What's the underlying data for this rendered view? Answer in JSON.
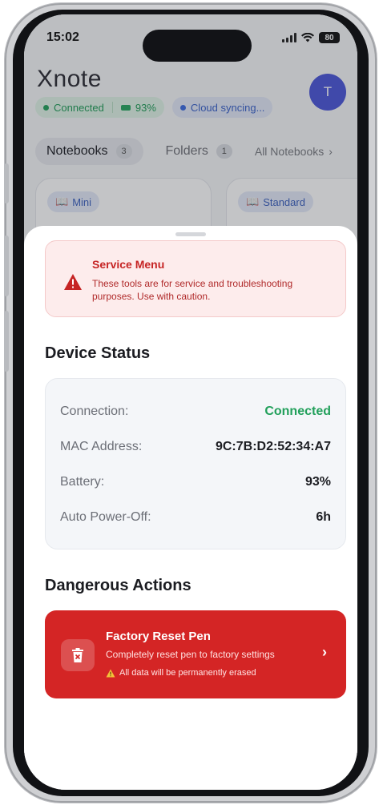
{
  "status_bar": {
    "time": "15:02",
    "battery": "80"
  },
  "app": {
    "logo": "Xnote",
    "avatar_initial": "T",
    "badges": {
      "connection": "Connected",
      "battery": "93%",
      "sync": "Cloud syncing..."
    },
    "tabs": [
      {
        "label": "Notebooks",
        "count": "3"
      },
      {
        "label": "Folders",
        "count": "1"
      }
    ],
    "all_notebooks_link": "All Notebooks",
    "notebook_tags": [
      "Mini",
      "Standard"
    ]
  },
  "sheet": {
    "warning": {
      "title": "Service Menu",
      "text": "These tools are for service and troubleshooting purposes. Use with caution."
    },
    "device_status": {
      "title": "Device Status",
      "rows": [
        {
          "label": "Connection:",
          "value": "Connected"
        },
        {
          "label": "MAC Address:",
          "value": "9C:7B:D2:52:34:A7"
        },
        {
          "label": "Battery:",
          "value": "93%"
        },
        {
          "label": "Auto Power-Off:",
          "value": "6h"
        }
      ]
    },
    "dangerous": {
      "title": "Dangerous Actions",
      "reset": {
        "title": "Factory Reset Pen",
        "subtitle": "Completely reset pen to factory settings",
        "warning": "All data will be permanently erased"
      }
    }
  },
  "colors": {
    "accent": "#4a55d8",
    "danger": "#d42525",
    "success": "#22a05b"
  }
}
